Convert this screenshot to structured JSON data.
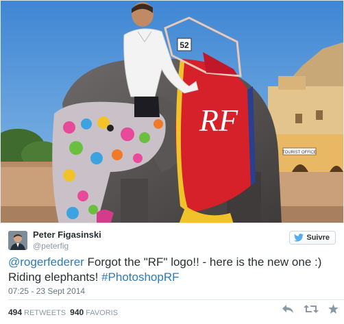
{
  "tweet": {
    "author_name": "Peter Figasinski",
    "author_handle": "@peterfig",
    "follow_label": "Suivre",
    "text": {
      "mention": "@rogerfederer",
      "body": " Forgot the \"RF\" logo!! - here is the new one :) Riding elephants! ",
      "hashtag": "#PhotoshopRF"
    },
    "timestamp": "07:25 - 23 Sept 2014",
    "retweets": {
      "count": "494",
      "label": "RETWEETS"
    },
    "favorites": {
      "count": "940",
      "label": "FAVORIS"
    }
  },
  "photo": {
    "number_plate": "52",
    "sign_text": "TOURIST OFFICE",
    "logo_text": "RF"
  },
  "colors": {
    "link": "#2b7bb9",
    "saddle_red": "#d6202a",
    "sky": "#4a8bd0"
  },
  "icons": [
    "twitter-bird-icon",
    "reply-icon",
    "retweet-icon",
    "favorite-star-icon"
  ]
}
